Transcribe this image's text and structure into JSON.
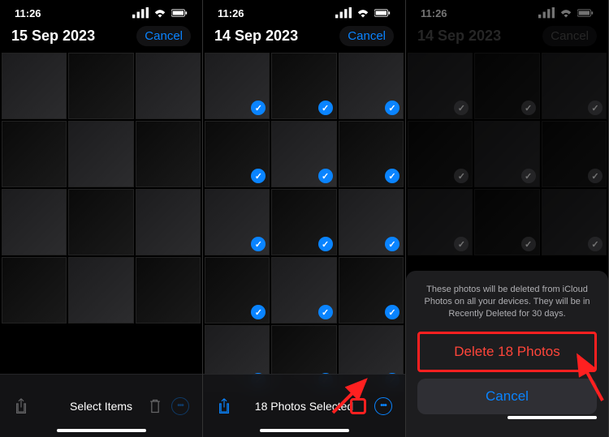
{
  "status": {
    "time": "11:26"
  },
  "screen1": {
    "date": "15 Sep 2023",
    "cancel": "Cancel",
    "bottom_label": "Select Items"
  },
  "screen2": {
    "date": "14 Sep 2023",
    "cancel": "Cancel",
    "bottom_label": "18 Photos Selected"
  },
  "screen3": {
    "date": "14 Sep 2023",
    "cancel": "Cancel",
    "sheet": {
      "description": "These photos will be deleted from iCloud Photos on all your devices. They will be in Recently Deleted for 30 days.",
      "delete_label": "Delete 18 Photos",
      "cancel_label": "Cancel"
    }
  }
}
